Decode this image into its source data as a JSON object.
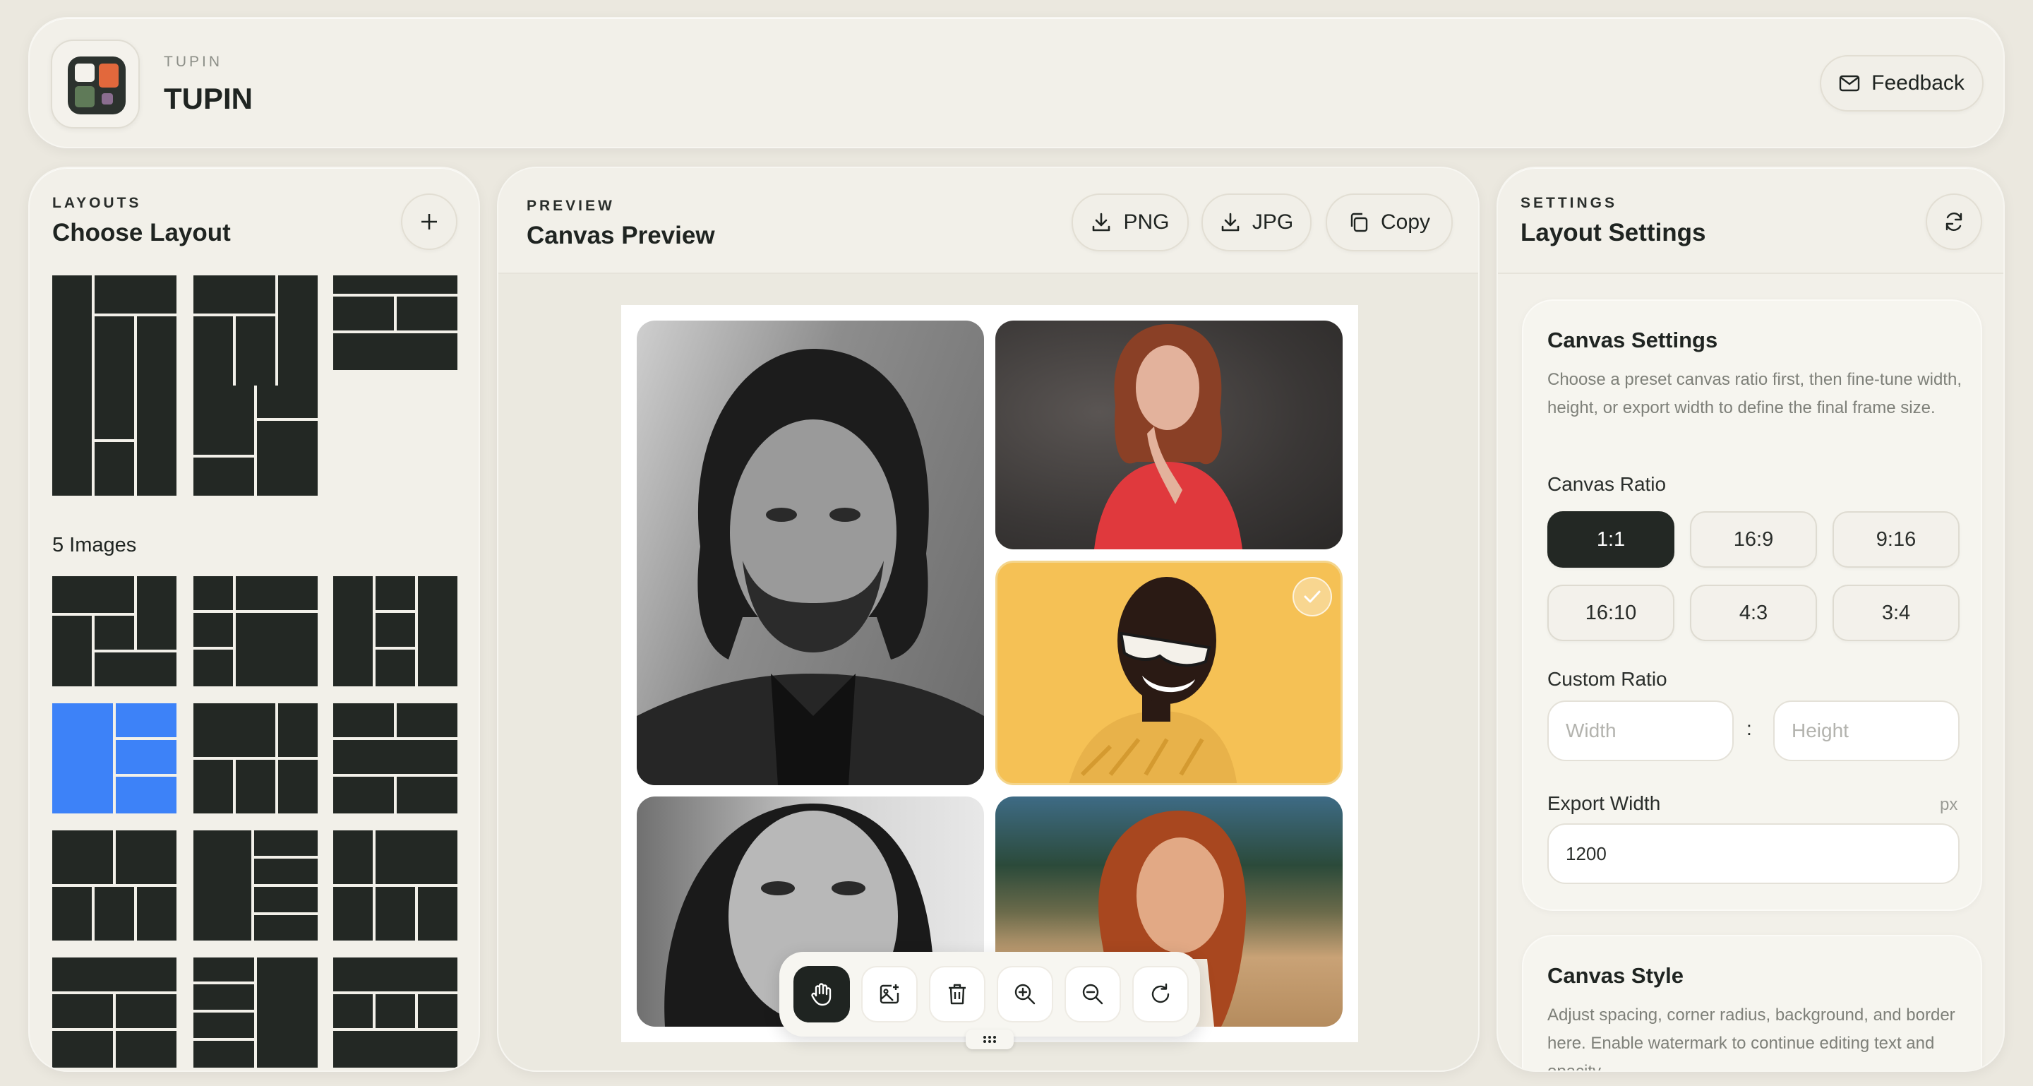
{
  "header": {
    "kicker": "TUPIN",
    "title": "TUPIN",
    "feedback_label": "Feedback"
  },
  "layouts": {
    "kicker": "LAYOUTS",
    "title": "Choose Layout",
    "section_5_label": "5 Images"
  },
  "preview": {
    "kicker": "PREVIEW",
    "title": "Canvas Preview",
    "png_label": "PNG",
    "jpg_label": "JPG",
    "copy_label": "Copy",
    "tools": [
      "hand-icon",
      "add-image-icon",
      "trash-icon",
      "zoom-in-icon",
      "zoom-out-icon",
      "refresh-icon"
    ]
  },
  "settings": {
    "kicker": "SETTINGS",
    "title": "Layout Settings",
    "canvas_settings": {
      "title": "Canvas Settings",
      "description": "Choose a preset canvas ratio first, then fine-tune width, height, or export width to define the final frame size.",
      "ratio_label": "Canvas Ratio",
      "ratios": [
        "1:1",
        "16:9",
        "9:16",
        "16:10",
        "4:3",
        "3:4"
      ],
      "selected_ratio": "1:1",
      "custom_ratio_label": "Custom Ratio",
      "width_placeholder": "Width",
      "height_placeholder": "Height",
      "separator": ":",
      "export_width_label": "Export Width",
      "export_unit": "px",
      "export_width_value": "1200"
    },
    "canvas_style": {
      "title": "Canvas Style",
      "description": "Adjust spacing, corner radius, background, and border here. Enable watermark to continue editing text and opacity."
    }
  },
  "colors": {
    "background": "#ebe8df",
    "panel": "#f2f0e9",
    "dark": "#232824",
    "accent_blue": "#3d82f8",
    "logo_orange": "#e2683c",
    "logo_green": "#5f7a58",
    "logo_purple": "#8a6d8f"
  }
}
